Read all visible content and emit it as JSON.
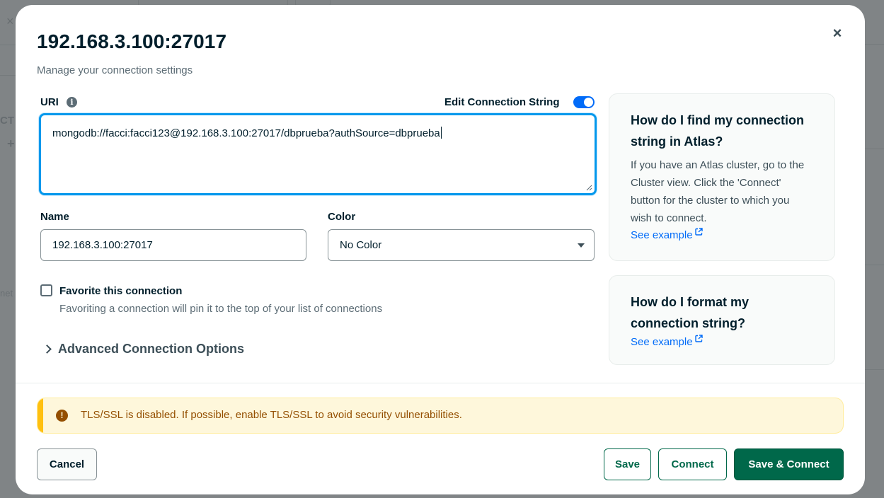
{
  "background": {
    "close_glyph": "×",
    "partial_text_ct": "CT",
    "partial_plus": "+",
    "partial_text_net": "net"
  },
  "modal": {
    "title": "192.168.3.100:27017",
    "subtitle": "Manage your connection settings",
    "close_glyph": "×",
    "uri": {
      "label": "URI",
      "info_glyph": "i",
      "edit_toggle_label": "Edit Connection String",
      "edit_toggle_on": true,
      "value": "mongodb://facci:facci123@192.168.3.100:27017/dbprueba?authSource=dbprueba"
    },
    "name": {
      "label": "Name",
      "value": "192.168.3.100:27017"
    },
    "color": {
      "label": "Color",
      "selected": "No Color"
    },
    "favorite": {
      "checked": false,
      "label": "Favorite this connection",
      "description": "Favoriting a connection will pin it to the top of your list of connections"
    },
    "advanced": {
      "label": "Advanced Connection Options"
    },
    "help": [
      {
        "title": "How do I find my connection string in Atlas?",
        "body": "If you have an Atlas cluster, go to the Cluster view. Click the 'Connect' button for the cluster to which you wish to connect.",
        "link": "See example"
      },
      {
        "title": "How do I format my connection string?",
        "link": "See example"
      }
    ],
    "banner": {
      "icon_glyph": "!",
      "text": "TLS/SSL is disabled. If possible, enable TLS/SSL to avoid security vulnerabilities."
    },
    "buttons": {
      "cancel": "Cancel",
      "save": "Save",
      "connect": "Connect",
      "save_connect": "Save & Connect"
    }
  },
  "colors": {
    "accent_blue": "#016bf8",
    "focus_blue": "#0498ec",
    "primary_green": "#00684a",
    "warning_bg": "#fef7db",
    "warning_bar": "#ffc010",
    "warning_text": "#944f01"
  }
}
